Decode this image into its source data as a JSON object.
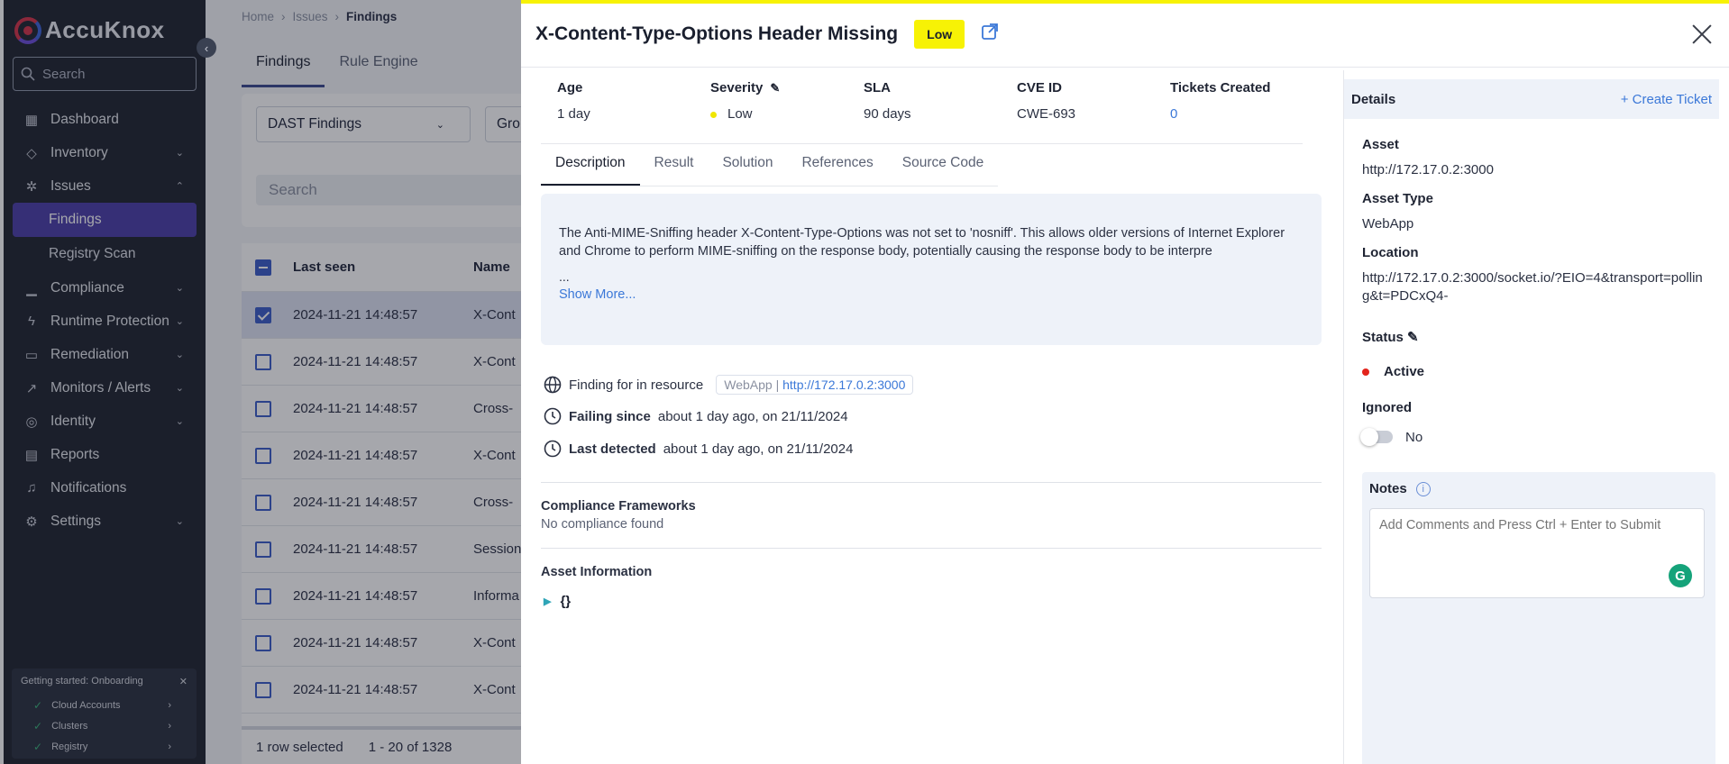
{
  "sidebar": {
    "logo_text": "AccuKnox",
    "search_placeholder": "Search",
    "items": [
      {
        "label": "Dashboard",
        "icon": "grid-icon"
      },
      {
        "label": "Inventory",
        "icon": "cube-icon"
      },
      {
        "label": "Issues",
        "icon": "bug-icon"
      },
      {
        "label": "Compliance",
        "icon": "chart-icon"
      },
      {
        "label": "Runtime Protection",
        "icon": "shield-icon"
      },
      {
        "label": "Remediation",
        "icon": "toolbox-icon"
      },
      {
        "label": "Monitors / Alerts",
        "icon": "trend-icon"
      },
      {
        "label": "Identity",
        "icon": "fingerprint-icon"
      },
      {
        "label": "Reports",
        "icon": "document-icon"
      },
      {
        "label": "Notifications",
        "icon": "bell-icon"
      },
      {
        "label": "Settings",
        "icon": "gear-icon"
      }
    ],
    "sub_items": [
      "Findings",
      "Registry Scan"
    ],
    "onboarding": {
      "title": "Getting started: Onboarding",
      "steps": [
        "Cloud Accounts",
        "Clusters",
        "Registry"
      ]
    }
  },
  "page": {
    "breadcrumb": [
      "Home",
      "Issues",
      "Findings"
    ],
    "tabs": [
      "Findings",
      "Rule Engine"
    ],
    "filter_dropdown": "DAST Findings",
    "group_dropdown": "Gro",
    "search_placeholder": "Search",
    "table": {
      "columns": [
        "Last seen",
        "Name"
      ],
      "rows": [
        {
          "last_seen": "2024-11-21 14:48:57",
          "name": "X-Cont",
          "selected": true
        },
        {
          "last_seen": "2024-11-21 14:48:57",
          "name": "X-Cont",
          "selected": false
        },
        {
          "last_seen": "2024-11-21 14:48:57",
          "name": "Cross-",
          "selected": false
        },
        {
          "last_seen": "2024-11-21 14:48:57",
          "name": "X-Cont",
          "selected": false
        },
        {
          "last_seen": "2024-11-21 14:48:57",
          "name": "Cross-",
          "selected": false
        },
        {
          "last_seen": "2024-11-21 14:48:57",
          "name": "Session",
          "selected": false
        },
        {
          "last_seen": "2024-11-21 14:48:57",
          "name": "Informa",
          "selected": false
        },
        {
          "last_seen": "2024-11-21 14:48:57",
          "name": "X-Cont",
          "selected": false
        },
        {
          "last_seen": "2024-11-21 14:48:57",
          "name": "X-Cont",
          "selected": false
        }
      ],
      "footer_selected": "1 row selected",
      "footer_range": "1 - 20 of 1328"
    }
  },
  "drawer": {
    "title": "X-Content-Type-Options Header Missing",
    "severity_badge": "Low",
    "meta": {
      "age_label": "Age",
      "age_value": "1 day",
      "severity_label": "Severity",
      "severity_value": "Low",
      "sla_label": "SLA",
      "sla_value": "90 days",
      "cve_label": "CVE ID",
      "cve_value": "CWE-693",
      "tickets_label": "Tickets Created",
      "tickets_value": "0"
    },
    "tabs": [
      "Description",
      "Result",
      "Solution",
      "References",
      "Source Code"
    ],
    "description": "The Anti-MIME-Sniffing header X-Content-Type-Options was not set to 'nosniff'. This allows older versions of Internet Explorer and Chrome to perform MIME-sniffing on the response body, potentially causing the response body to be interpre",
    "ellipsis": "...",
    "show_more": "Show More...",
    "finding_label": "Finding for in resource",
    "resource_type": "WebApp",
    "resource_sep": "|",
    "resource_link": "http://172.17.0.2:3000",
    "failing_label": "Failing since",
    "failing_value": "about 1 day ago, on 21/11/2024",
    "detected_label": "Last detected",
    "detected_value": "about 1 day ago, on 21/11/2024",
    "compliance_title": "Compliance Frameworks",
    "compliance_value": "No compliance found",
    "asset_info_title": "Asset Information",
    "asset_info_tree": "{}",
    "details": {
      "title": "Details",
      "create_ticket": "+ Create Ticket",
      "asset_label": "Asset",
      "asset_value": "http://172.17.0.2:3000",
      "asset_type_label": "Asset Type",
      "asset_type_value": "WebApp",
      "location_label": "Location",
      "location_value": "http://172.17.0.2:3000/socket.io/?EIO=4&transport=polling&t=PDCxQ4-",
      "status_label": "Status",
      "status_value": "Active",
      "ignored_label": "Ignored",
      "ignored_value": "No",
      "notes_label": "Notes",
      "notes_placeholder": "Add Comments and Press Ctrl + Enter to Submit"
    },
    "colors": {
      "severity_low": "#f7f205",
      "status_active": "#e3241c",
      "link": "#3b78d8"
    }
  }
}
